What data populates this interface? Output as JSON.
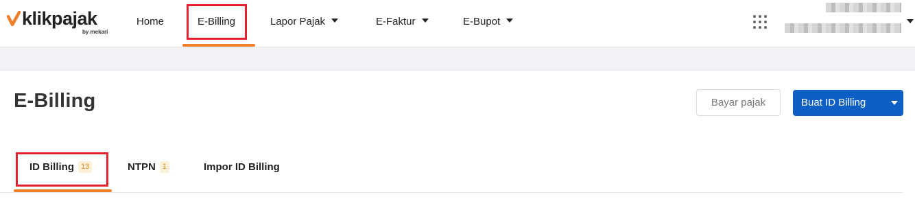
{
  "brand": {
    "name": "klikpajak",
    "tagline": "by mekari",
    "accent_color": "#f07f2a",
    "primary_color": "#0e5fc5",
    "highlight_color": "#e0232e"
  },
  "nav": {
    "items": [
      {
        "label": "Home"
      },
      {
        "label": "E-Billing",
        "active": true
      },
      {
        "label": "Lapor Pajak",
        "dropdown": true
      },
      {
        "label": "E-Faktur",
        "dropdown": true
      },
      {
        "label": "E-Bupot",
        "dropdown": true
      }
    ],
    "apps_icon": "grid-dots-icon"
  },
  "page": {
    "title": "E-Billing",
    "pay_button": "Bayar pajak",
    "create_button": "Buat ID Billing"
  },
  "tabs": [
    {
      "label": "ID Billing",
      "count": "13",
      "active": true
    },
    {
      "label": "NTPN",
      "count": "1"
    },
    {
      "label": "Impor ID Billing"
    }
  ]
}
